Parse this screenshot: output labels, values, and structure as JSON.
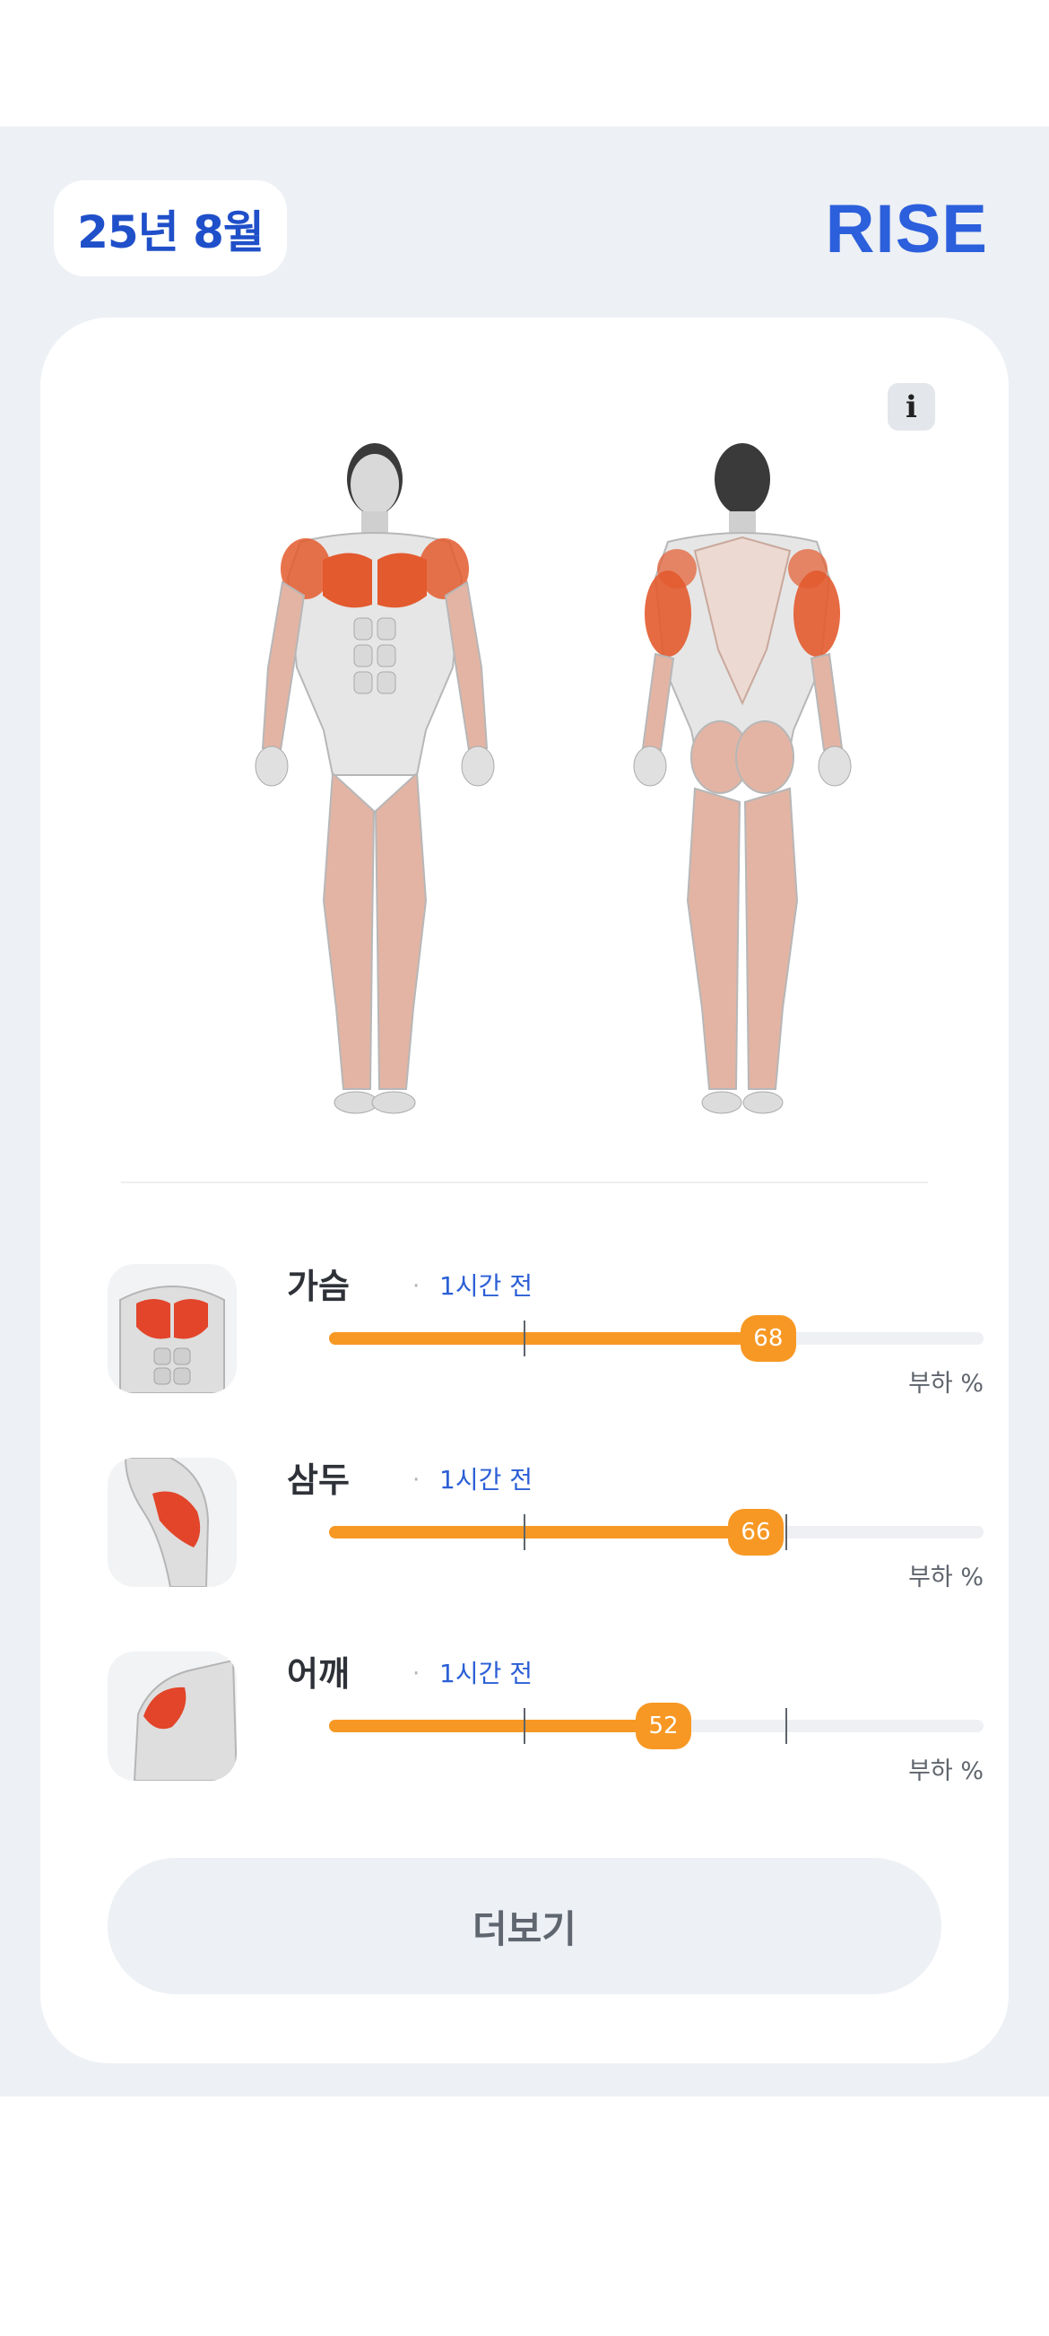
{
  "header": {
    "date_label": "25년 8월",
    "logo_text": "RISE"
  },
  "card": {
    "info_button": "i",
    "muscles": [
      {
        "name": "가슴",
        "separator": "·",
        "time": "1시간 전",
        "load": 68,
        "load_text": "68",
        "unit_label": "부하 %",
        "thumb": "chest"
      },
      {
        "name": "삼두",
        "separator": "·",
        "time": "1시간 전",
        "load": 66,
        "load_text": "66",
        "unit_label": "부하 %",
        "thumb": "triceps"
      },
      {
        "name": "어깨",
        "separator": "·",
        "time": "1시간 전",
        "load": 52,
        "load_text": "52",
        "unit_label": "부하 %",
        "thumb": "shoulder"
      }
    ],
    "more_button": "더보기"
  },
  "colors": {
    "brand_blue": "#2c5fdc",
    "accent_orange": "#f79824",
    "muscle_highlight": "#e35a2e",
    "background": "#edf0f4"
  }
}
